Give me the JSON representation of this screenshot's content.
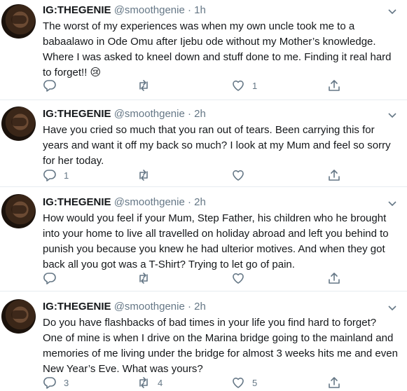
{
  "tweets": [
    {
      "name": "IG:THEGENIE",
      "handle": "@smoothgenie",
      "sep": "·",
      "time": "1h",
      "lines": [
        "The worst of my experiences was when my own uncle took me to a",
        "babaalawo in Ode Omu after Ijebu ode without my Mother’s knowledge.",
        "Where I was asked to kneel down and stuff done to me. Finding it real hard",
        "to forget!! 😢"
      ],
      "reply_count": "",
      "retweet_count": "",
      "like_count": "1"
    },
    {
      "name": "IG:THEGENIE",
      "handle": "@smoothgenie",
      "sep": "·",
      "time": "2h",
      "lines": [
        "Have you cried so much that you ran out of tears. Been carrying this for",
        "years and want it off my back so much? I look at my Mum and feel so sorry",
        "for her today."
      ],
      "reply_count": "1",
      "retweet_count": "",
      "like_count": ""
    },
    {
      "name": "IG:THEGENIE",
      "handle": "@smoothgenie",
      "sep": "·",
      "time": "2h",
      "lines": [
        "How would you feel if your Mum, Step Father, his children who he brought",
        "into your home to live all travelled on holiday abroad and left you behind to",
        "punish you because you knew he had ulterior motives. And when they got",
        "back all you got was a T-Shirt? Trying to let go of pain."
      ],
      "reply_count": "",
      "retweet_count": "",
      "like_count": ""
    },
    {
      "name": "IG:THEGENIE",
      "handle": "@smoothgenie",
      "sep": "·",
      "time": "2h",
      "lines": [
        "Do you have flashbacks of bad times in your life you find hard to forget?",
        "One of mine is when I drive on the Marina bridge going to the mainland and",
        "memories of me living under the bridge for almost 3 weeks hits me and even",
        "New Year’s Eve. What was yours?"
      ],
      "reply_count": "3",
      "retweet_count": "4",
      "like_count": "5"
    }
  ],
  "icons": {
    "reply": "reply-icon",
    "retweet": "retweet-icon",
    "like": "heart-icon",
    "share": "share-icon",
    "more": "chevron-down-icon"
  },
  "colors": {
    "text": "#14171a",
    "muted": "#657786",
    "divider": "#e6ecf0"
  }
}
